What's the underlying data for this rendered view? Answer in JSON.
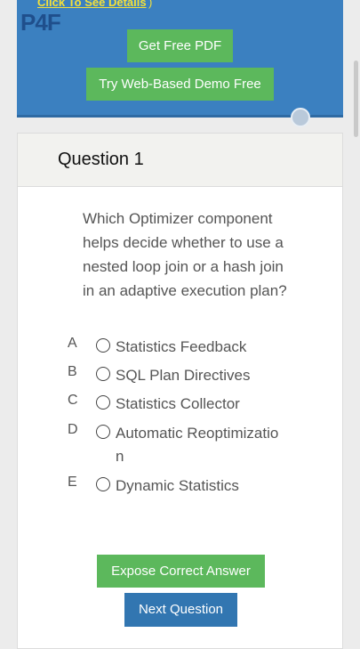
{
  "promo": {
    "link_text": "Click To See Details",
    "link_tail": ")",
    "logo_text_left": "P",
    "logo_text_four": "4",
    "logo_text_right": "F",
    "pdf_button": "Get Free PDF",
    "demo_button": "Try Web-Based Demo Free"
  },
  "question": {
    "title": "Question 1",
    "text": "Which Optimizer component helps decide whether to use a nested loop join or a hash join in an adaptive execution plan?",
    "options": [
      {
        "letter": "A",
        "label": "Statistics Feedback"
      },
      {
        "letter": "B",
        "label": "SQL Plan Directives"
      },
      {
        "letter": "C",
        "label": "Statistics Collector"
      },
      {
        "letter": "D",
        "label": "Automatic Reoptimization"
      },
      {
        "letter": "E",
        "label": "Dynamic Statistics"
      }
    ]
  },
  "actions": {
    "expose_button": "Expose Correct Answer",
    "next_button": "Next Question"
  },
  "colors": {
    "promo_bg": "#3b80c0",
    "green": "#5cb85c",
    "blue": "#3276b1",
    "link": "#f4e03a"
  }
}
